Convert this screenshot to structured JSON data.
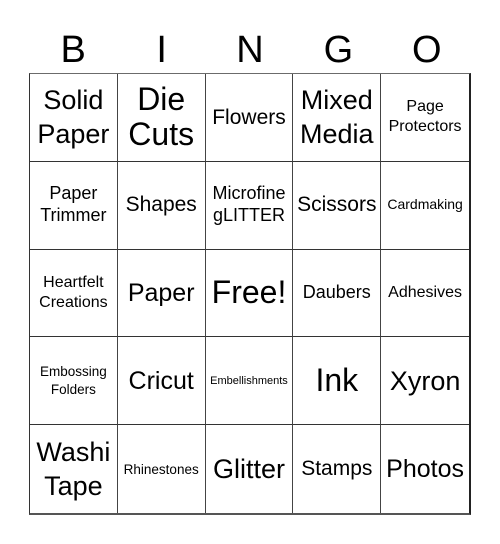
{
  "header": {
    "letters": [
      "B",
      "I",
      "N",
      "G",
      "O"
    ]
  },
  "board": {
    "rows": [
      [
        {
          "text": "Solid Paper",
          "lines": [
            "Solid",
            "Paper"
          ]
        },
        {
          "text": "Die Cuts",
          "lines": [
            "Die",
            "Cuts"
          ]
        },
        {
          "text": "Flowers",
          "lines": [
            "Flowers"
          ]
        },
        {
          "text": "Mixed Media",
          "lines": [
            "Mixed",
            "Media"
          ]
        },
        {
          "text": "Page Protectors",
          "lines": [
            "Page",
            "Protectors"
          ]
        }
      ],
      [
        {
          "text": "Paper Trimmer",
          "lines": [
            "Paper",
            "Trimmer"
          ]
        },
        {
          "text": "Shapes",
          "lines": [
            "Shapes"
          ]
        },
        {
          "text": "Microfine gLITTER",
          "lines": [
            "Microfine",
            "gLITTER"
          ]
        },
        {
          "text": "Scissors",
          "lines": [
            "Scissors"
          ]
        },
        {
          "text": "Cardmaking",
          "lines": [
            "Cardmaking"
          ]
        }
      ],
      [
        {
          "text": "Heartfelt Creations",
          "lines": [
            "Heartfelt",
            "Creations"
          ]
        },
        {
          "text": "Paper",
          "lines": [
            "Paper"
          ]
        },
        {
          "text": "Free!",
          "lines": [
            "Free!"
          ]
        },
        {
          "text": "Daubers",
          "lines": [
            "Daubers"
          ]
        },
        {
          "text": "Adhesives",
          "lines": [
            "Adhesives"
          ]
        }
      ],
      [
        {
          "text": "Embossing Folders",
          "lines": [
            "Embossing",
            "Folders"
          ]
        },
        {
          "text": "Cricut",
          "lines": [
            "Cricut"
          ]
        },
        {
          "text": "Embellishments",
          "lines": [
            "Embellishments"
          ]
        },
        {
          "text": "Ink",
          "lines": [
            "Ink"
          ]
        },
        {
          "text": "Xyron",
          "lines": [
            "Xyron"
          ]
        }
      ],
      [
        {
          "text": "Washi Tape",
          "lines": [
            "Washi",
            "Tape"
          ]
        },
        {
          "text": "Rhinestones",
          "lines": [
            "Rhinestones"
          ]
        },
        {
          "text": "Glitter",
          "lines": [
            "Glitter"
          ]
        },
        {
          "text": "Stamps",
          "lines": [
            "Stamps"
          ]
        },
        {
          "text": "Photos",
          "lines": [
            "Photos"
          ]
        }
      ]
    ]
  }
}
